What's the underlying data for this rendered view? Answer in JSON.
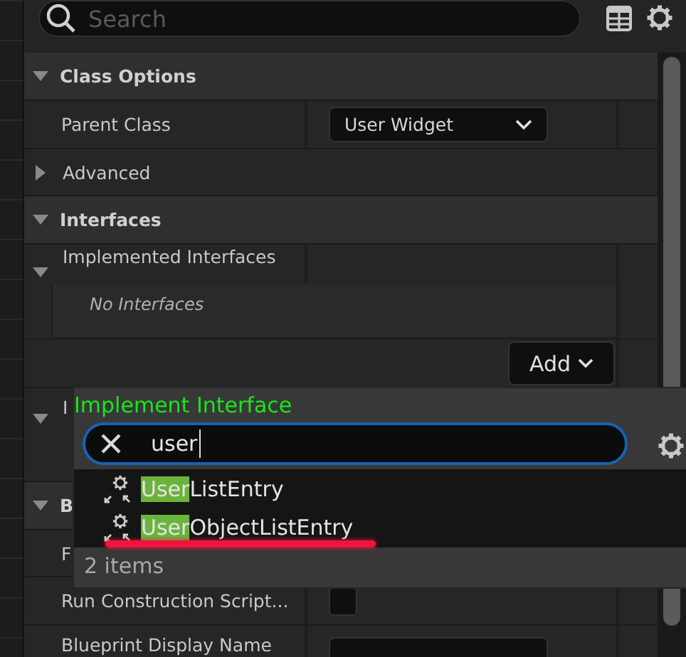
{
  "search": {
    "placeholder": "Search"
  },
  "sections": [
    {
      "title": "Class Options",
      "expanded": true,
      "rows": [
        {
          "kind": "dropdown",
          "label": "Parent Class",
          "value": "User Widget"
        },
        {
          "kind": "group",
          "label": "Advanced",
          "expanded": false
        }
      ]
    },
    {
      "title": "Interfaces",
      "expanded": true,
      "rows": [
        {
          "kind": "array",
          "label": "Implemented Interfaces",
          "expanded": true,
          "empty_text": "No Interfaces",
          "button": "Add"
        },
        {
          "kind": "group",
          "label": "I",
          "expanded": true
        }
      ]
    },
    {
      "title": "B",
      "expanded": true,
      "rows": [
        {
          "kind": "text",
          "label": "F"
        },
        {
          "kind": "checkbox",
          "label": "Run Construction Script...",
          "checked": false
        },
        {
          "kind": "field",
          "label": "Blueprint Display Name"
        }
      ]
    }
  ],
  "popup": {
    "title": "Implement Interface",
    "query": "user",
    "items": [
      {
        "match": "User",
        "rest": "ListEntry",
        "selected": false
      },
      {
        "match": "User",
        "rest": "ObjectListEntry",
        "selected": false
      }
    ],
    "count": "2 items"
  }
}
